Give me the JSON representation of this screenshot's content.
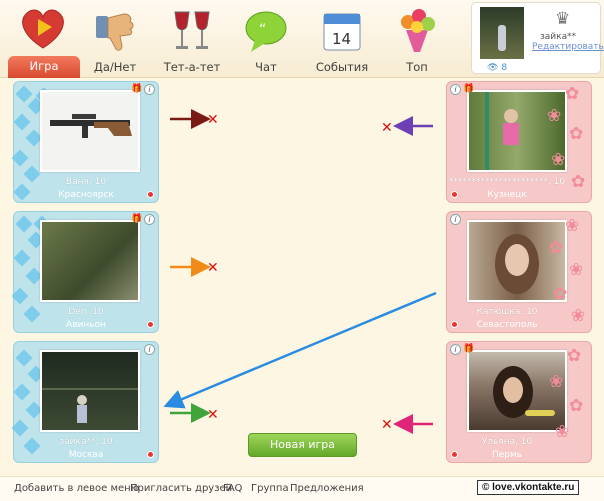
{
  "tabs": [
    {
      "label": "Игра",
      "icon": "heart-play-icon"
    },
    {
      "label": "Да/Нет",
      "icon": "thumbs-down-icon"
    },
    {
      "label": "Тет-а-тет",
      "icon": "wine-glasses-icon"
    },
    {
      "label": "Чат",
      "icon": "chat-bubble-icon"
    },
    {
      "label": "События",
      "icon": "calendar-icon"
    },
    {
      "label": "Топ",
      "icon": "flowers-icon"
    }
  ],
  "calendar_day": "14",
  "profile": {
    "name": "зайка**",
    "edit_label": "Редактировать",
    "views": "8"
  },
  "players_left": [
    {
      "name": "Ваня, 10",
      "city": "Красноярск",
      "photo": "rifle-photo"
    },
    {
      "name": "Den, 10",
      "city": "Авиньон",
      "photo": "camouflage-photo"
    },
    {
      "name": "зайка**, 10",
      "city": "Москва",
      "photo": "night-yard-photo"
    }
  ],
  "players_right": [
    {
      "name": "**********************, 10",
      "city": "Кузнецк",
      "photo": "girl-pole-photo"
    },
    {
      "name": "Катюшка, 10",
      "city": "Севастополь",
      "photo": "girl-hair-photo"
    },
    {
      "name": "Ульяна, 10",
      "city": "Пермь",
      "photo": "girl-dark-photo"
    }
  ],
  "new_game_label": "Новая игра",
  "footer": {
    "links": [
      "Добавить в левое меню",
      "Пригласить друзей",
      "FAQ",
      "Группа",
      "Предложения"
    ],
    "brand": "© love.vkontakte.ru"
  },
  "colors": {
    "accent_tab": "#e2593b",
    "left_card": "#bfe3eb",
    "right_card": "#f6c9c8",
    "button": "#7dbe3c"
  }
}
